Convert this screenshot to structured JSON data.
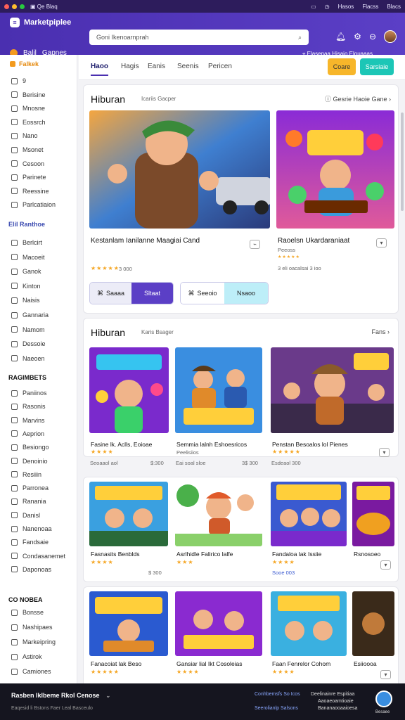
{
  "system": {
    "app_name": "Qe Blaq",
    "right_items": [
      "Hasos",
      "Flacss",
      "Blacs"
    ]
  },
  "header": {
    "brand": "Marketpiplee",
    "search_placeholder": "Goni Ikenoarnprah",
    "store_label": "Balil",
    "store_name": "Gapnes",
    "location_text": "Elasenaa Hisaio Elouaaas"
  },
  "sidebar": {
    "featured": "Falkek",
    "group1": [
      "9",
      "Berisine",
      "Mnosne",
      "Eossrch",
      "Nano",
      "Msonet",
      "Cesoon",
      "Parinete",
      "Reessine",
      "Parlcatiaion"
    ],
    "group2_title": "Elil Ranthoe",
    "group2": [
      "Berlcirt",
      "Macoeit",
      "Ganok",
      "Kinton",
      "Naisis",
      "Gannaria",
      "Namom",
      "Dessoie",
      "Naeoen"
    ],
    "group3_title": "RAGIMBETS",
    "group3": [
      "Paniinos",
      "Rasonis",
      "Marvins",
      "Aeprion",
      "Besiongo",
      "Denoinio",
      "Resiiin",
      "Parronea",
      "Ranania",
      "Danisl",
      "Nanenoaa",
      "Fandsaie",
      "Condasanemet",
      "Daponoas"
    ],
    "group4_title": "CO NOBEA",
    "group4": [
      "Bonsse",
      "Nashipaes",
      "Markeipring",
      "Astirok",
      "Camiones"
    ]
  },
  "tabs": [
    "Haoo",
    "Hagis",
    "Eanis",
    "Seenis",
    "Pericen"
  ],
  "tab_buttons": {
    "orange": "Coare",
    "teal": "Sarsiaie"
  },
  "section1": {
    "title": "Hiburan",
    "subtitle": "Icariis Gacper",
    "link": "Gesrie Haoie Gane",
    "items": [
      {
        "title": "Kestanlam Ianilanne Maagiai Cand",
        "price": "3 000"
      },
      {
        "title": "Raoelsn Ukardaraniaat",
        "sub": "Peeoss",
        "meta": "3 eli oacalsai 3 ioo"
      }
    ],
    "buttons": {
      "a": "Saaaa",
      "b": "Sltaat",
      "c": "Seeoio",
      "d": "Nsaoo"
    }
  },
  "section2": {
    "title": "Hiburan",
    "subtitle": "Karis Bsager",
    "link": "Fans",
    "row1": [
      {
        "title": "Fasine lk. Aclls, Eoioae",
        "meta": "Seoaaol aol",
        "price": "$:300"
      },
      {
        "title": "Semmia lalnh Eshoesricos",
        "sub": "Peelisiios",
        "meta": "Eai soal sloe",
        "price": "3$ 300"
      },
      {
        "title": "Penstan Besoalos lol Pienes",
        "meta": "Esdeaol 300"
      }
    ],
    "row2": [
      {
        "title": "Fasnasits Benblds",
        "price": "$ 300"
      },
      {
        "title": "Asrlhidle Falirico lalfe"
      },
      {
        "title": "Fandaloa lak Issiie",
        "meta": "Sooe 003"
      },
      {
        "title": "Rsnosoeo"
      }
    ],
    "row3": [
      {
        "title": "Fanacoiat lak Beso"
      },
      {
        "title": "Gansiar lial Ikt Cosoleias"
      },
      {
        "title": "Faan Fenrelor Cohom"
      },
      {
        "title": "Esiioooa"
      }
    ]
  },
  "footer": {
    "title": "Rasben lklbeme Rkol Cenose",
    "sub": "Eaqesid li Bstons Faer Leal Basceulo",
    "col1": [
      "Conhbemsfs So Icos",
      "Seerolianlp Salsons"
    ],
    "col2": [
      "Deelinainre Espitiaa",
      "Aaoaeoamtioaie",
      "Bananaooaaioesa"
    ],
    "avatar_label": "Besaee"
  },
  "colors": {
    "brand": "#4a2fb0",
    "accent_orange": "#f7b62a",
    "accent_teal": "#1cc6b6",
    "star": "#f5a623"
  }
}
